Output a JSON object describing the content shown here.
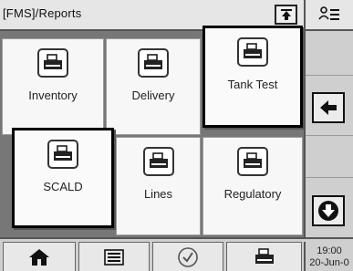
{
  "header": {
    "title": "[FMS]/Reports",
    "collapse_icon": "up-arrow-box-icon"
  },
  "right_header": {
    "icon": "user-list-icon"
  },
  "tiles": [
    {
      "label": "Inventory",
      "icon": "printer-icon"
    },
    {
      "label": "Delivery",
      "icon": "printer-icon"
    },
    {
      "label": "Tank Test",
      "icon": "printer-icon"
    },
    {
      "label": "SCALD",
      "icon": "printer-icon"
    },
    {
      "label": "Lines",
      "icon": "printer-icon"
    },
    {
      "label": "Regulatory",
      "icon": "printer-icon"
    }
  ],
  "side": {
    "back_icon": "left-arrow-icon",
    "down_icon": "down-arrow-icon"
  },
  "bottom": {
    "buttons": [
      "home-icon",
      "list-icon",
      "check-icon",
      "printer-icon"
    ],
    "time": "19:00",
    "date": "20-Jun-0"
  }
}
